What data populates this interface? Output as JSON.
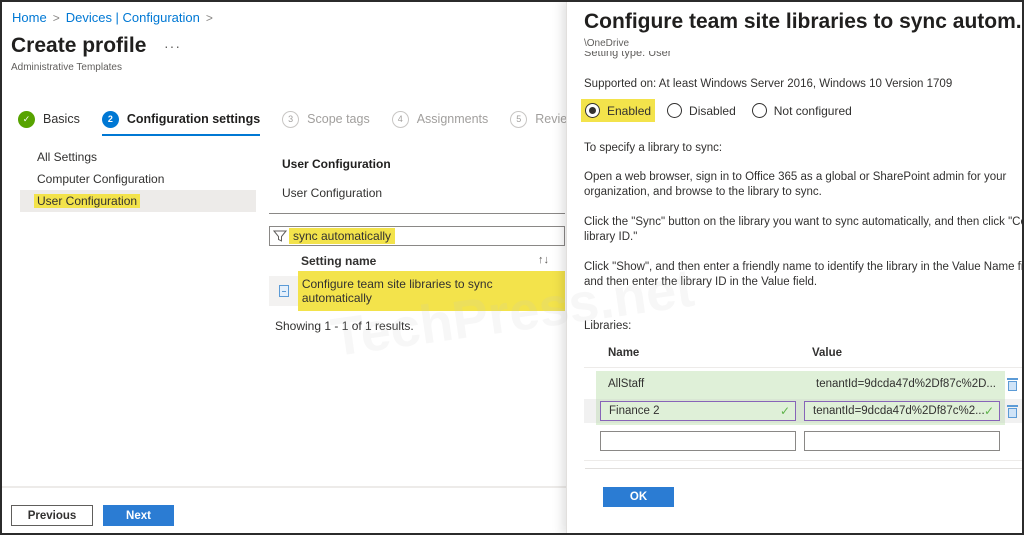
{
  "breadcrumb": [
    {
      "label": "Home"
    },
    {
      "label": "Devices | Configuration"
    }
  ],
  "page": {
    "title": "Create profile",
    "more_label": "···",
    "subtitle": "Administrative Templates"
  },
  "wizard": {
    "steps": [
      {
        "number": "✓",
        "label": "Basics",
        "state": "done"
      },
      {
        "number": "2",
        "label": "Configuration settings",
        "state": "active"
      },
      {
        "number": "3",
        "label": "Scope tags",
        "state": "pending"
      },
      {
        "number": "4",
        "label": "Assignments",
        "state": "pending"
      },
      {
        "number": "5",
        "label": "Review +",
        "state": "pending"
      }
    ]
  },
  "leftnav": {
    "items": [
      {
        "label": "All Settings"
      },
      {
        "label": "Computer Configuration"
      },
      {
        "label": "User Configuration",
        "selected": true
      }
    ]
  },
  "content": {
    "section_title": "User Configuration",
    "section_subtitle": "User Configuration",
    "filter_value": "sync automatically",
    "column_header": "Setting name",
    "sort_icon": "↑↓",
    "rows": [
      {
        "label": "Configure team site libraries to sync automatically"
      }
    ],
    "showing": "Showing 1 - 1 of 1 results."
  },
  "footer": {
    "previous_label": "Previous",
    "next_label": "Next"
  },
  "panel": {
    "title": "Configure team site libraries to sync autom...",
    "path": "\\OneDrive",
    "setting_type": "Setting type: User",
    "supported_on": "Supported on: At least Windows Server 2016, Windows 10 Version 1709",
    "radios": [
      {
        "label": "Enabled",
        "checked": true
      },
      {
        "label": "Disabled",
        "checked": false
      },
      {
        "label": "Not configured",
        "checked": false
      }
    ],
    "description": [
      "To specify a library to sync:",
      "Open a web browser, sign in to Office 365 as a global or SharePoint admin for your",
      "organization, and browse to the library to sync.",
      "Click the \"Sync\" button on the library you want to sync automatically, and then click \"Copy",
      "library ID.\"",
      "Click \"Show\", and then enter a friendly name to identify the library in the Value Name field,",
      "and then enter the library ID in the Value field."
    ],
    "libraries_label": "Libraries:",
    "libraries_headers": {
      "name": "Name",
      "value": "Value"
    },
    "libraries": [
      {
        "name": "AllStaff",
        "value": "tenantId=9dcda47d%2Df87c%2D..."
      },
      {
        "name": "Finance 2",
        "value": "tenantId=9dcda47d%2Df87c%2..."
      },
      {
        "name": "",
        "value": ""
      }
    ],
    "ok_label": "OK"
  },
  "watermark": "TechPress.net",
  "colors": {
    "accent": "#0078d4",
    "button_primary": "#2b7cd3",
    "highlight": "#f3e34b",
    "success": "#57a300",
    "valid_row": "#dff0d8"
  }
}
